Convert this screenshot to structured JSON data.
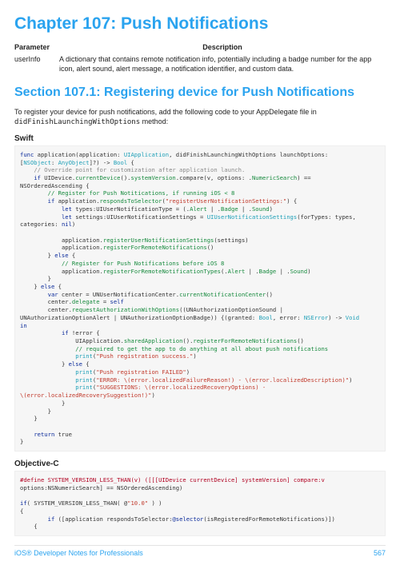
{
  "chapter_title": "Chapter 107: Push Notifications",
  "table": {
    "header_param": "Parameter",
    "header_desc": "Description",
    "row1_key": "userInfo",
    "row1_val": "A dictionary that contains remote notification info, potentially including a badge number for the app icon, alert sound, alert message, a notification identifier, and custom data."
  },
  "section_title": "Section 107.1: Registering device for Push Notifications",
  "intro_a": "To register your device for push notifications, add the following code to your AppDelegate file in ",
  "intro_b": "didFinishLaunchingWithOptions",
  "intro_c": " method:",
  "swift_label": "Swift",
  "objc_label": "Objective-C",
  "swift": {
    "l01a": "func",
    "l01b": " application(application: ",
    "l01c": "UIApplication",
    "l01d": ", didFinishLaunchingWithOptions launchOptions:",
    "l02a": "[",
    "l02b": "NSObject",
    "l02c": ": ",
    "l02d": "AnyObject",
    "l02e": "]?) -> ",
    "l02f": "Bool",
    "l02g": " {",
    "l03": "    // Override point for customization after application launch.",
    "l04a": "    if",
    "l04b": " UIDevice.",
    "l04c": "currentDevice",
    "l04d": "().",
    "l04e": "systemVersion",
    "l04f": ".compare(v, options: .",
    "l04g": "NumericSearch",
    "l04h": ") ==",
    "l05": "NSOrderedAscending {",
    "l06": "        // Register for Push Notitications, if running iOS < 8",
    "l07a": "        if",
    "l07b": " application.",
    "l07c": "respondsToSelector",
    "l07d": "(",
    "l07e": "\"registerUserNotificationSettings:\"",
    "l07f": ") {",
    "l08a": "            let",
    "l08b": " types:UIUserNotificationType = (.",
    "l08c": "Alert",
    "l08d": " | .",
    "l08e": "Badge",
    "l08f": " | .",
    "l08g": "Sound",
    "l08h": ")",
    "l09a": "            let",
    "l09b": " settings:UIUserNotificationSettings = ",
    "l09c": "UIUserNotificationSettings",
    "l09d": "(forTypes: types,",
    "l10a": "categories: ",
    "l10b": "nil",
    "l10c": ")",
    "l11": "",
    "l12a": "            application.",
    "l12b": "registerUserNotificationSettings",
    "l12c": "(settings)",
    "l13a": "            application.",
    "l13b": "registerForRemoteNotifications",
    "l13c": "()",
    "l14a": "        } ",
    "l14b": "else",
    "l14c": " {",
    "l15": "            // Register for Push Notifications before iOS 8",
    "l16a": "            application.",
    "l16b": "registerForRemoteNotificationTypes",
    "l16c": "(.",
    "l16d": "Alert",
    "l16e": " | .",
    "l16f": "Badge",
    "l16g": " | .",
    "l16h": "Sound",
    "l16i": ")",
    "l17": "        }",
    "l18a": "    } ",
    "l18b": "else",
    "l18c": " {",
    "l19a": "        var",
    "l19b": " center = UNUserNotificationCenter.",
    "l19c": "currentNotificationCenter",
    "l19d": "()",
    "l20a": "        center.",
    "l20b": "delegate",
    "l20c": " = ",
    "l20d": "self",
    "l21a": "        center.",
    "l21b": "requestAuthorizationWithOptions",
    "l21c": "((UNAuthorizationOptionSound |",
    "l22a": "UNAuthorizationOptionAlert | UNAuthorizationOptionBadge)) {(granted: ",
    "l22b": "Bool",
    "l22c": ", error: ",
    "l22d": "NSError",
    "l22e": ") -> ",
    "l22f": "Void",
    "l23": "in",
    "l24a": "            if",
    "l24b": " !error {",
    "l25a": "                UIApplication.",
    "l25b": "sharedApplication",
    "l25c": "().",
    "l25d": "registerForRemoteNotifications",
    "l25e": "()",
    "l26": "                // required to get the app to do anything at all about push notifications",
    "l27a": "                print",
    "l27b": "(",
    "l27c": "\"Push registration success.\"",
    "l27d": ")",
    "l28a": "            } ",
    "l28b": "else",
    "l28c": " {",
    "l29a": "                print",
    "l29b": "(",
    "l29c": "\"Push registration FAILED\"",
    "l29d": ")",
    "l30a": "                print",
    "l30b": "(",
    "l30c": "\"ERROR: \\(error.localizedFailureReason!) - \\(error.localizedDescription)\"",
    "l30d": ")",
    "l31a": "                print",
    "l31b": "(",
    "l31c": "\"SUGGESTIONS: \\(error.localizedRecoveryOptions) -",
    "l32a": "\\(error.localizedRecoverySuggestion!)\"",
    "l32b": ")",
    "l33": "            }",
    "l34": "        }",
    "l35": "    }",
    "l36": "",
    "l37a": "    return",
    "l37b": " true",
    "l38": "}"
  },
  "objc": {
    "l01a": "#define SYSTEM_VERSION_LESS_THAN(v) ([[[UIDevice currentDevice] systemVersion] compare:v",
    "l02": "options:NSNumericSearch] == NSOrderedAscending)",
    "l03": "",
    "l04a": "if",
    "l04b": "( SYSTEM_VERSION_LESS_THAN( @",
    "l04c": "\"10.0\"",
    "l04d": " ) )",
    "l05": "{",
    "l06a": "        if",
    "l06b": " ([application respondsToSelector:",
    "l06c": "@selector",
    "l06d": "(isRegisteredForRemoteNotifications)])",
    "l07": "    {"
  },
  "footer_left": "iOS® Developer Notes for Professionals",
  "footer_right": "567"
}
